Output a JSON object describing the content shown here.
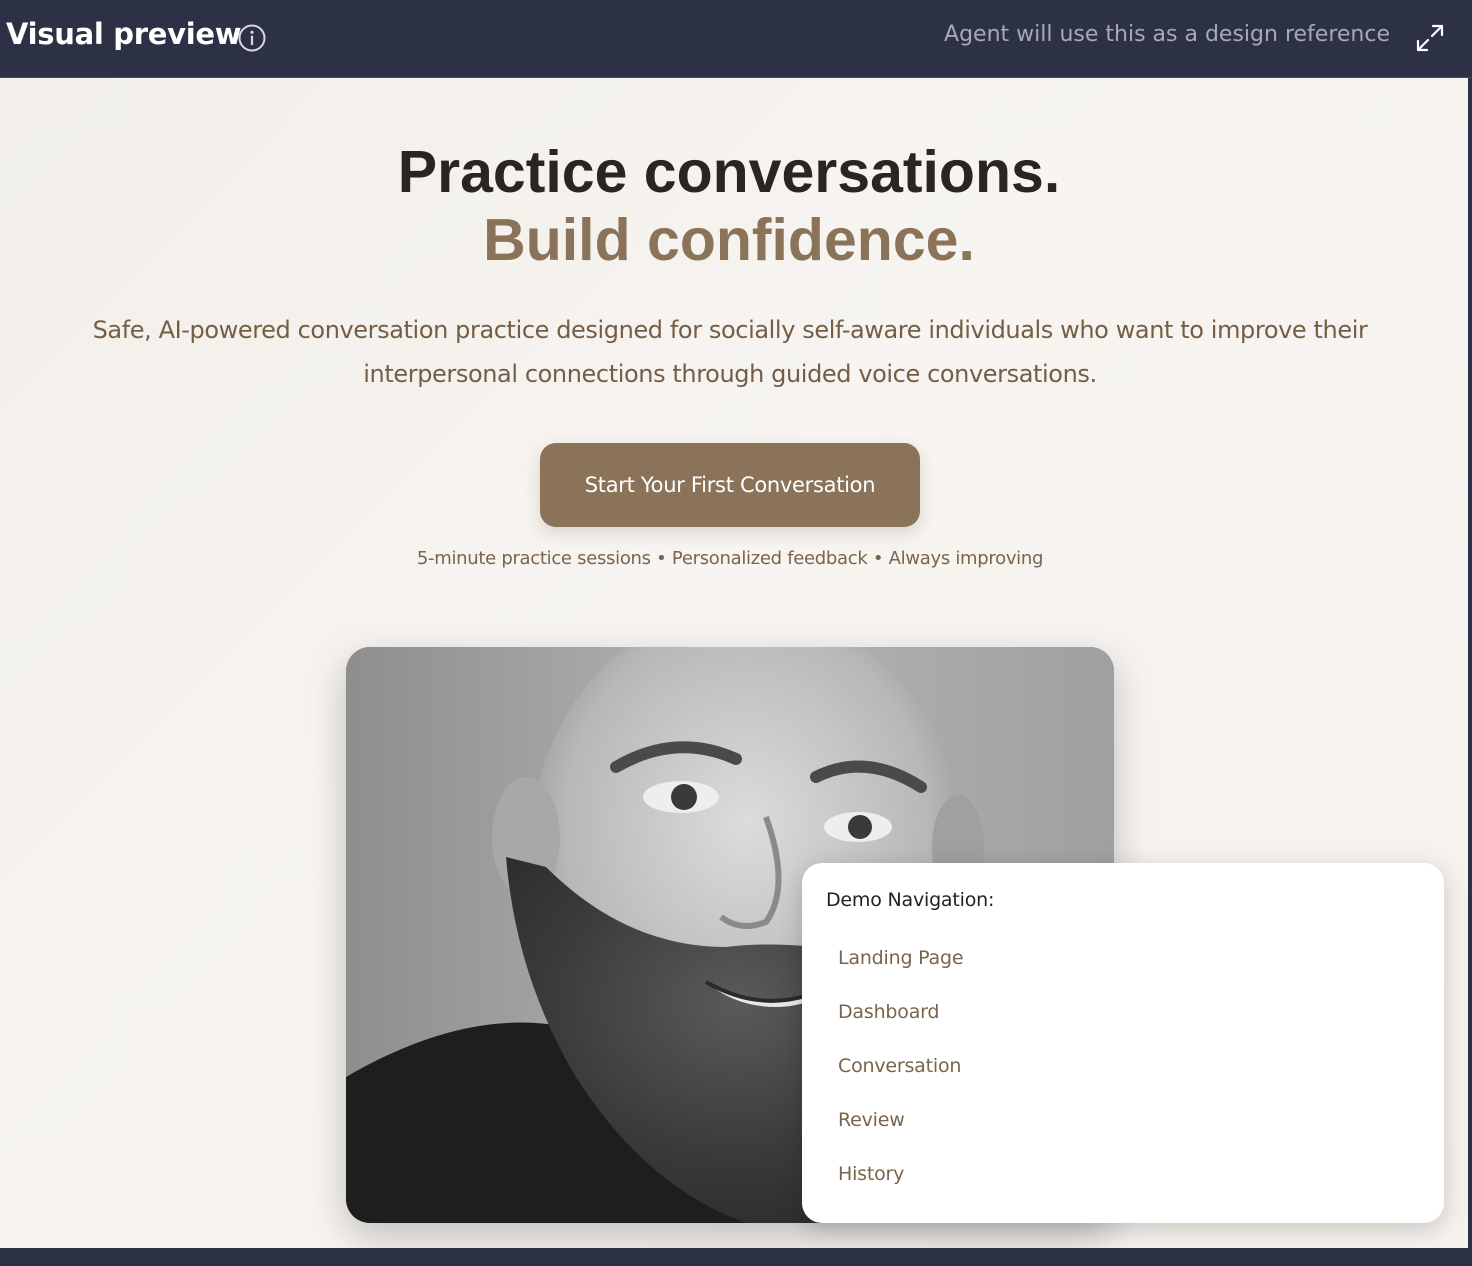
{
  "header": {
    "title": "Visual preview",
    "note": "Agent will use this as a design reference",
    "icons": [
      "info-icon",
      "expand-icon"
    ]
  },
  "hero": {
    "title_line1": "Practice conversations.",
    "title_line2": "Build confidence.",
    "subtitle": "Safe, AI-powered conversation practice designed for socially self-aware individuals who want to improve their interpersonal connections through guided voice conversations.",
    "cta_label": "Start Your First Conversation",
    "features": "5-minute practice sessions • Personalized feedback • Always improving"
  },
  "demo_nav": {
    "title": "Demo Navigation:",
    "links": [
      "Landing Page",
      "Dashboard",
      "Conversation",
      "Review",
      "History"
    ]
  },
  "colors": {
    "header_bg": "#2d3145",
    "accent": "#8a7358",
    "text_dark": "#28261f",
    "text_muted": "#745e46"
  }
}
